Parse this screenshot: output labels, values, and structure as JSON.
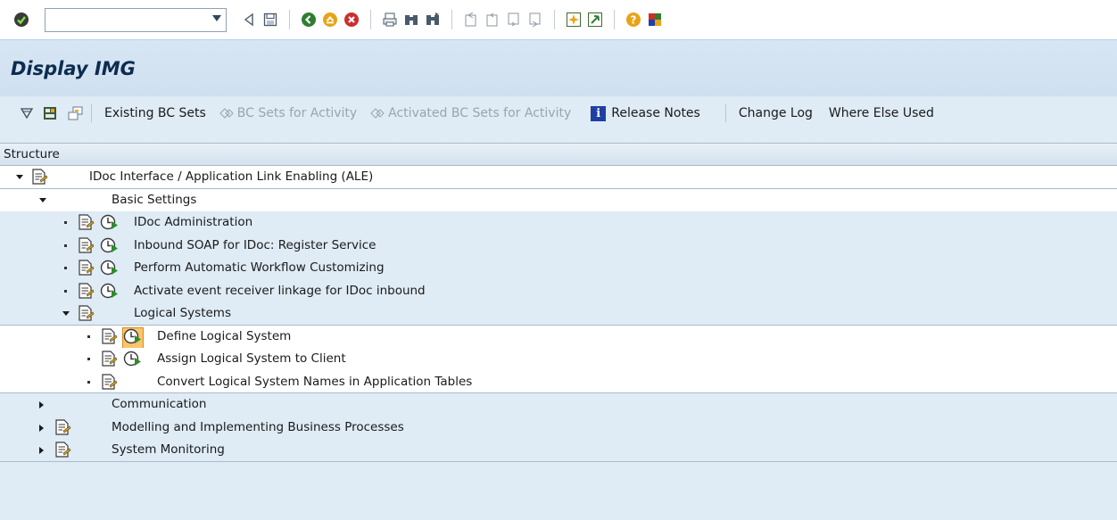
{
  "toolbar": {
    "command_field_value": "",
    "icons": [
      "enter-icon",
      "dropdown-icon",
      "back-nav-icon",
      "save-icon",
      "back-icon",
      "exit-icon",
      "cancel-icon",
      "print-icon",
      "find-icon",
      "find-next-icon",
      "first-page-icon",
      "previous-page-icon",
      "next-page-icon",
      "last-page-icon",
      "create-session-icon",
      "shortcut-icon",
      "help-icon",
      "customize-layout-icon"
    ]
  },
  "title": "Display IMG",
  "app_toolbar": {
    "existing_bc_sets": "Existing BC Sets",
    "bc_sets_for_activity": "BC Sets for Activity",
    "activated_bc_sets": "Activated BC Sets for Activity",
    "release_notes": "Release Notes",
    "change_log": "Change Log",
    "where_else_used": "Where Else Used"
  },
  "tree": {
    "header": "Structure",
    "nodes": [
      {
        "label": "IDoc Interface / Application Link Enabling (ALE)",
        "level": 0,
        "expander": "expanded",
        "doc": true,
        "exec": false
      },
      {
        "label": "Basic Settings",
        "level": 1,
        "expander": "expanded",
        "doc": false,
        "exec": false
      },
      {
        "label": "IDoc Administration",
        "level": 2,
        "expander": "leaf",
        "doc": true,
        "exec": true
      },
      {
        "label": "Inbound SOAP for IDoc: Register Service",
        "level": 2,
        "expander": "leaf",
        "doc": true,
        "exec": true
      },
      {
        "label": "Perform Automatic Workflow Customizing",
        "level": 2,
        "expander": "leaf",
        "doc": true,
        "exec": true
      },
      {
        "label": "Activate event receiver linkage for IDoc inbound",
        "level": 2,
        "expander": "leaf",
        "doc": true,
        "exec": true
      },
      {
        "label": "Logical Systems",
        "level": 2,
        "expander": "expanded",
        "doc": true,
        "exec": false
      },
      {
        "label": "Define Logical System",
        "level": 3,
        "expander": "leaf",
        "doc": true,
        "exec": true,
        "selected": true
      },
      {
        "label": "Assign Logical System to Client",
        "level": 3,
        "expander": "leaf",
        "doc": true,
        "exec": true
      },
      {
        "label": "Convert Logical System Names in Application Tables",
        "level": 3,
        "expander": "leaf",
        "doc": true,
        "exec": false
      },
      {
        "label": "Communication",
        "level": 1,
        "expander": "collapsed",
        "doc": false,
        "exec": false
      },
      {
        "label": "Modelling and Implementing Business Processes",
        "level": 1,
        "expander": "collapsed",
        "doc": true,
        "exec": false
      },
      {
        "label": "System Monitoring",
        "level": 1,
        "expander": "collapsed",
        "doc": true,
        "exec": false
      }
    ]
  },
  "colors": {
    "background": "#dfebf5",
    "title_text": "#0d2c4f",
    "selection": "#f9c46a",
    "exec_green": "#2e8b2e"
  }
}
